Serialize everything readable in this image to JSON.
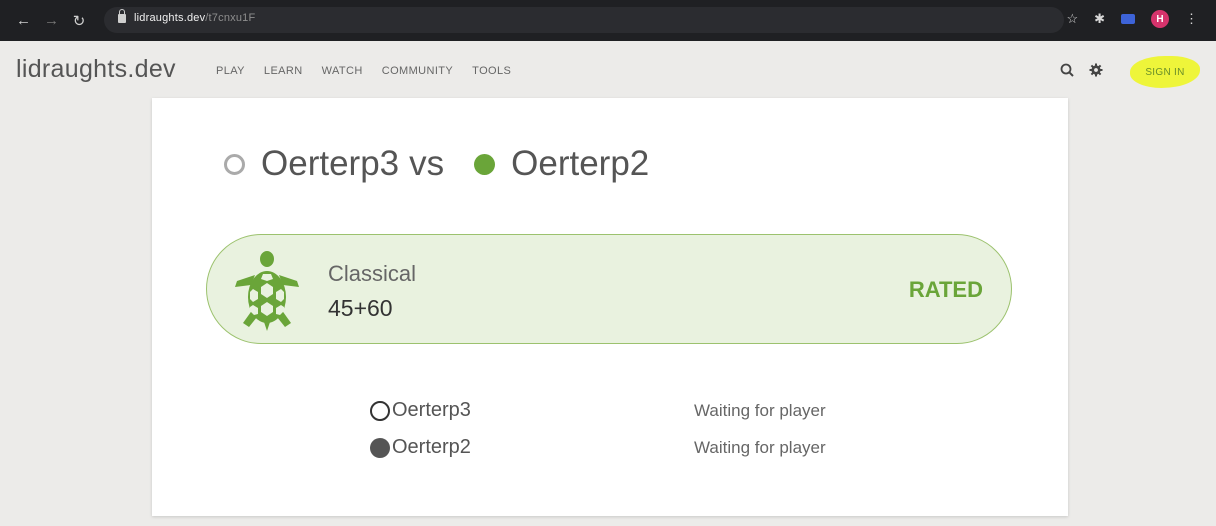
{
  "browser": {
    "url_host": "lidraughts.dev",
    "url_path": "/t7cnxu1F",
    "avatar_initial": "H"
  },
  "header": {
    "logo": "lidraughts.dev",
    "menu": [
      "PLAY",
      "LEARN",
      "WATCH",
      "COMMUNITY",
      "TOOLS"
    ],
    "signin": "SIGN IN",
    "icons": [
      "search-icon",
      "gear-icon"
    ]
  },
  "challenge": {
    "white_player": "Oerterp3",
    "vs": "vs",
    "black_player": "Oerterp2",
    "speed": "Classical",
    "clock": "45+60",
    "mode": "RATED",
    "players": [
      {
        "name": "Oerterp3",
        "status": "Waiting for player"
      },
      {
        "name": "Oerterp2",
        "status": "Waiting for player"
      }
    ]
  },
  "colors": {
    "accent_green": "#6aa539",
    "highlight_yellow": "#eef53a"
  }
}
